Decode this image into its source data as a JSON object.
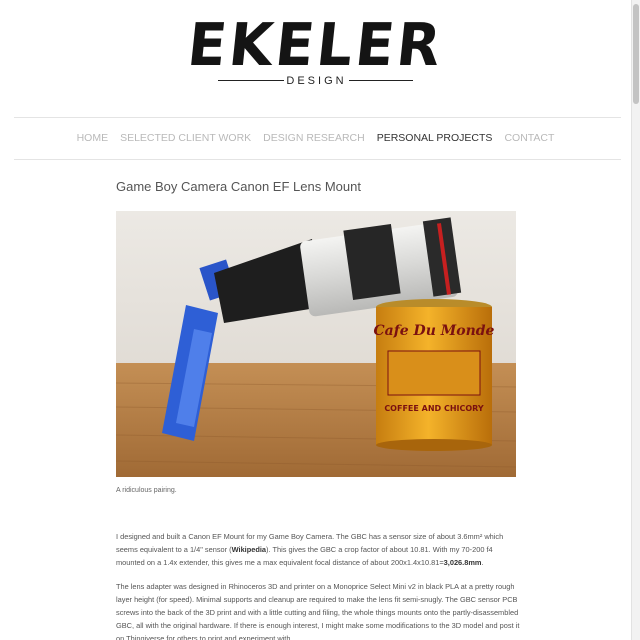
{
  "brand": {
    "name": "EKELER",
    "tagline": "DESIGN"
  },
  "nav": {
    "items": [
      {
        "label": "HOME"
      },
      {
        "label": "SELECTED CLIENT WORK"
      },
      {
        "label": "DESIGN RESEARCH"
      },
      {
        "label": "PERSONAL PROJECTS"
      },
      {
        "label": "CONTACT"
      }
    ],
    "active_index": 3
  },
  "post": {
    "title": "Game Boy Camera Canon EF Lens Mount",
    "image_caption": "A ridiculous pairing.",
    "image_can_label_1": "Cafe Du Monde",
    "image_can_label_2": "COFFEE AND CHICORY",
    "para1": {
      "t1": "I designed and built a Canon EF Mount for my Game Boy Camera. The GBC has a sensor size of about 3.6mm² which seems equivalent to a 1/4\" sensor (",
      "link": "Wikipedia",
      "t2": "). This gives the GBC a crop factor of about 10.81. With my 70-200 f4 mounted on a 1.4x extender, this gives me a max equivalent focal distance of about 200x1.4x10.81=",
      "bold": "3,026.8mm",
      "t3": "."
    },
    "para2": "The lens adapter was designed in Rhinoceros 3D and printer on a Monoprice Select Mini v2 in black PLA at a pretty rough layer height (for speed). Minimal supports and cleanup are required to make the lens fit semi-snugly. The GBC sensor PCB screws into the back of the 3D print and with a little cutting and filing, the whole things mounts onto the partly-disassembled GBC, all with the original hardware. If there is enough interest, I might make some modifications to the 3D model and post it on Thingiverse for others to print and experiment with."
  },
  "colors": {
    "nav_inactive": "#b9b9b9",
    "nav_active": "#333333",
    "divider": "#e4e4e4"
  }
}
